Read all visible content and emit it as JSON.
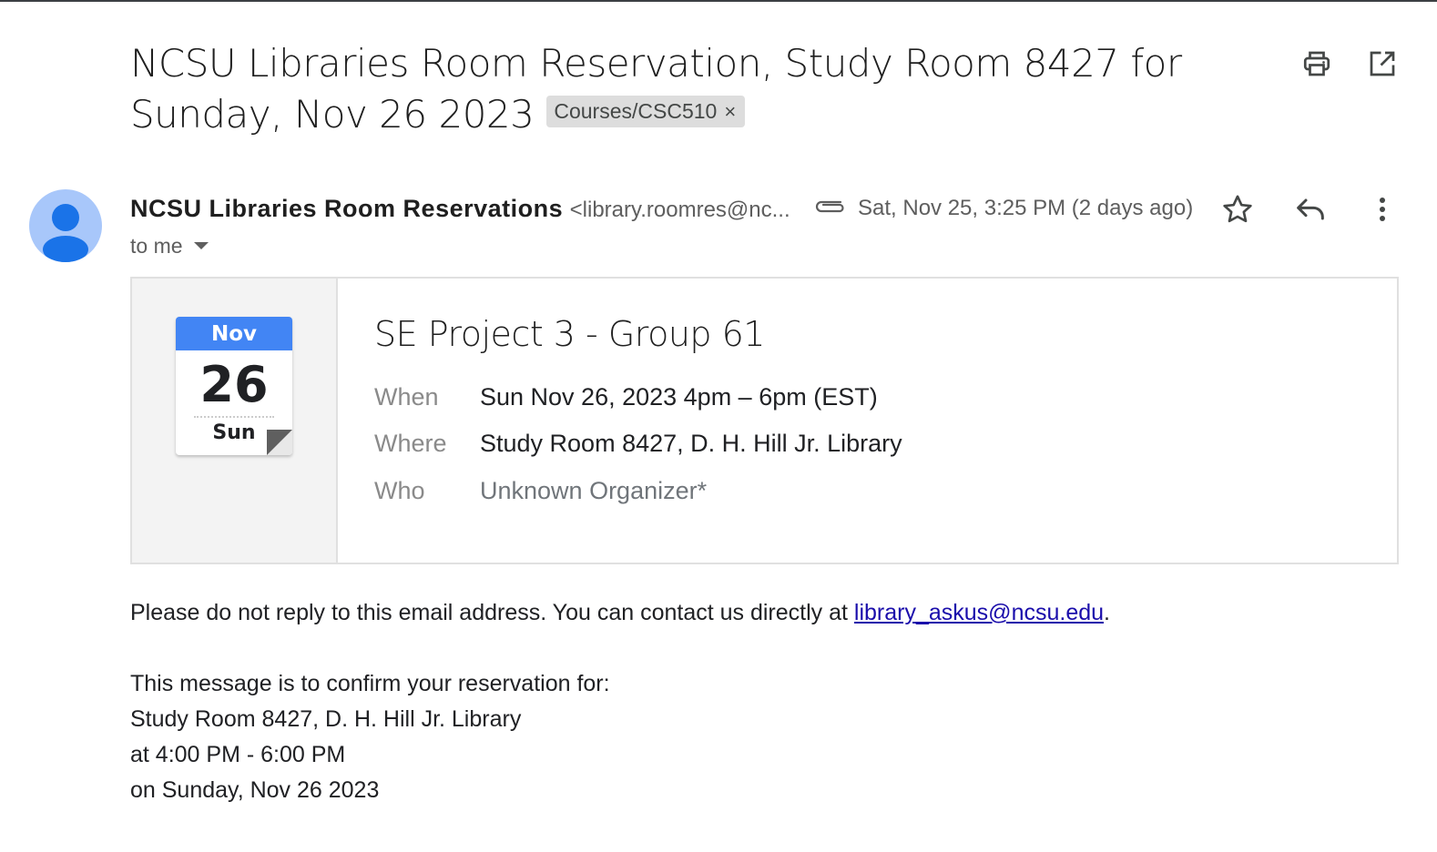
{
  "subject": {
    "title": "NCSU Libraries Room Reservation, Study Room 8427 for Sunday, Nov 26 2023",
    "label": "Courses/CSC510",
    "label_close": "×"
  },
  "actions": {
    "print_icon": "print-icon",
    "open_new_window_icon": "open-in-new-icon",
    "star_icon": "star-icon",
    "reply_icon": "reply-icon",
    "more_icon": "more-vert-icon"
  },
  "sender": {
    "name": "NCSU Libraries Room Reservations",
    "email": "<library.roomres@nc...",
    "to": "to me",
    "date": "Sat, Nov 25, 3:25 PM (2 days ago)"
  },
  "invite": {
    "month": "Nov",
    "day": "26",
    "weekday": "Sun",
    "title": "SE Project 3 - Group 61",
    "when_label": "When",
    "when_value": "Sun Nov 26, 2023 4pm – 6pm (EST)",
    "where_label": "Where",
    "where_value": "Study Room 8427, D. H. Hill Jr. Library",
    "who_label": "Who",
    "who_value": "Unknown Organizer*"
  },
  "body": {
    "notice_prefix": "Please do not reply to this email address. You can contact us directly at ",
    "notice_link": "library_askus@ncsu.edu",
    "notice_suffix": ".",
    "line1": "This message is to confirm your reservation for:",
    "line2": "Study Room 8427, D. H. Hill Jr. Library",
    "line3": "at 4:00 PM - 6:00 PM",
    "line4": "on Sunday, Nov 26 2023"
  },
  "colors": {
    "accent_blue": "#4285f4",
    "avatar_bg": "#a8c7fa",
    "avatar_fg": "#1a73e8",
    "link": "#1a0dab"
  }
}
